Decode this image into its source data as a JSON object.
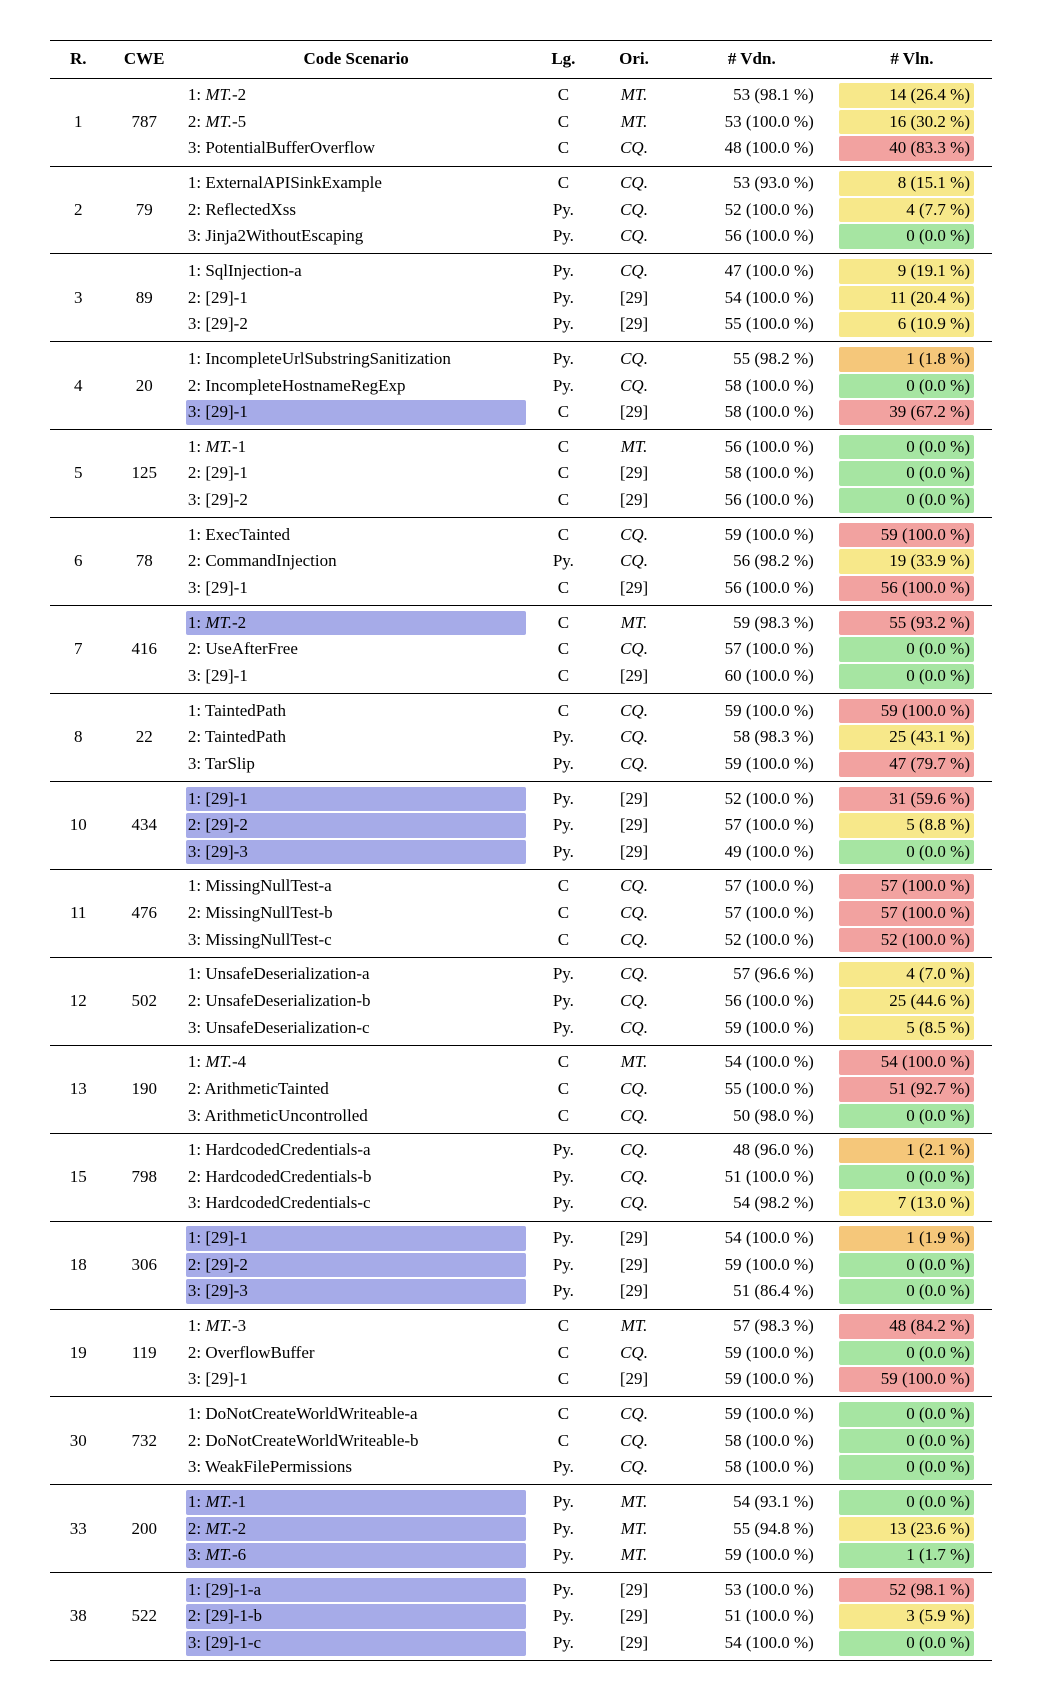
{
  "headers": {
    "r": "R.",
    "cwe": "CWE",
    "scenario": "Code Scenario",
    "lg": "Lg.",
    "ori": "Ori.",
    "vdn": "# Vdn.",
    "vln": "# Vln."
  },
  "groups": [
    {
      "rank": "1",
      "cwe": "787",
      "rows": [
        {
          "sc_pre": "1: ",
          "sc_it": "MT.",
          "sc_post": "-2",
          "sc_hl": "",
          "lg": "C",
          "ori": "MT.",
          "ori_norm": false,
          "vdn": "53 (98.1 %)",
          "vln": "14 (26.4 %)",
          "vln_hl": "hl-yellow"
        },
        {
          "sc_pre": "2: ",
          "sc_it": "MT.",
          "sc_post": "-5",
          "sc_hl": "",
          "lg": "C",
          "ori": "MT.",
          "ori_norm": false,
          "vdn": "53 (100.0 %)",
          "vln": "16 (30.2 %)",
          "vln_hl": "hl-yellow"
        },
        {
          "sc_pre": "3: PotentialBufferOverflow",
          "sc_it": "",
          "sc_post": "",
          "sc_hl": "",
          "lg": "C",
          "ori": "CQ.",
          "ori_norm": false,
          "vdn": "48 (100.0 %)",
          "vln": "40 (83.3 %)",
          "vln_hl": "hl-red"
        }
      ]
    },
    {
      "rank": "2",
      "cwe": "79",
      "rows": [
        {
          "sc_pre": "1: ExternalAPISinkExample",
          "sc_it": "",
          "sc_post": "",
          "sc_hl": "",
          "lg": "C",
          "ori": "CQ.",
          "ori_norm": false,
          "vdn": "53 (93.0 %)",
          "vln": "8 (15.1 %)",
          "vln_hl": "hl-yellow"
        },
        {
          "sc_pre": "2: ReflectedXss",
          "sc_it": "",
          "sc_post": "",
          "sc_hl": "",
          "lg": "Py.",
          "ori": "CQ.",
          "ori_norm": false,
          "vdn": "52 (100.0 %)",
          "vln": "4 (7.7 %)",
          "vln_hl": "hl-yellow"
        },
        {
          "sc_pre": "3: Jinja2WithoutEscaping",
          "sc_it": "",
          "sc_post": "",
          "sc_hl": "",
          "lg": "Py.",
          "ori": "CQ.",
          "ori_norm": false,
          "vdn": "56 (100.0 %)",
          "vln": "0 (0.0 %)",
          "vln_hl": "hl-green"
        }
      ]
    },
    {
      "rank": "3",
      "cwe": "89",
      "rows": [
        {
          "sc_pre": "1: SqlInjection-a",
          "sc_it": "",
          "sc_post": "",
          "sc_hl": "",
          "lg": "Py.",
          "ori": "CQ.",
          "ori_norm": false,
          "vdn": "47 (100.0 %)",
          "vln": "9 (19.1 %)",
          "vln_hl": "hl-yellow"
        },
        {
          "sc_pre": "2: [29]-1",
          "sc_it": "",
          "sc_post": "",
          "sc_hl": "",
          "lg": "Py.",
          "ori": "[29]",
          "ori_norm": true,
          "vdn": "54 (100.0 %)",
          "vln": "11 (20.4 %)",
          "vln_hl": "hl-yellow"
        },
        {
          "sc_pre": "3: [29]-2",
          "sc_it": "",
          "sc_post": "",
          "sc_hl": "",
          "lg": "Py.",
          "ori": "[29]",
          "ori_norm": true,
          "vdn": "55 (100.0 %)",
          "vln": "6 (10.9 %)",
          "vln_hl": "hl-yellow"
        }
      ]
    },
    {
      "rank": "4",
      "cwe": "20",
      "rows": [
        {
          "sc_pre": "1: IncompleteUrlSubstringSanitization",
          "sc_it": "",
          "sc_post": "",
          "sc_hl": "",
          "lg": "Py.",
          "ori": "CQ.",
          "ori_norm": false,
          "vdn": "55 (98.2 %)",
          "vln": "1 (1.8 %)",
          "vln_hl": "hl-orange"
        },
        {
          "sc_pre": "2: IncompleteHostnameRegExp",
          "sc_it": "",
          "sc_post": "",
          "sc_hl": "",
          "lg": "Py.",
          "ori": "CQ.",
          "ori_norm": false,
          "vdn": "58 (100.0 %)",
          "vln": "0 (0.0 %)",
          "vln_hl": "hl-green"
        },
        {
          "sc_pre": "3: [29]-1",
          "sc_it": "",
          "sc_post": "",
          "sc_hl": "hl-blue",
          "lg": "C",
          "ori": "[29]",
          "ori_norm": true,
          "vdn": "58 (100.0 %)",
          "vln": "39 (67.2 %)",
          "vln_hl": "hl-red"
        }
      ]
    },
    {
      "rank": "5",
      "cwe": "125",
      "rows": [
        {
          "sc_pre": "1: ",
          "sc_it": "MT.",
          "sc_post": "-1",
          "sc_hl": "",
          "lg": "C",
          "ori": "MT.",
          "ori_norm": false,
          "vdn": "56 (100.0 %)",
          "vln": "0 (0.0 %)",
          "vln_hl": "hl-green"
        },
        {
          "sc_pre": "2: [29]-1",
          "sc_it": "",
          "sc_post": "",
          "sc_hl": "",
          "lg": "C",
          "ori": "[29]",
          "ori_norm": true,
          "vdn": "58 (100.0 %)",
          "vln": "0 (0.0 %)",
          "vln_hl": "hl-green"
        },
        {
          "sc_pre": "3: [29]-2",
          "sc_it": "",
          "sc_post": "",
          "sc_hl": "",
          "lg": "C",
          "ori": "[29]",
          "ori_norm": true,
          "vdn": "56 (100.0 %)",
          "vln": "0 (0.0 %)",
          "vln_hl": "hl-green"
        }
      ]
    },
    {
      "rank": "6",
      "cwe": "78",
      "rows": [
        {
          "sc_pre": "1: ExecTainted",
          "sc_it": "",
          "sc_post": "",
          "sc_hl": "",
          "lg": "C",
          "ori": "CQ.",
          "ori_norm": false,
          "vdn": "59 (100.0 %)",
          "vln": "59 (100.0 %)",
          "vln_hl": "hl-red"
        },
        {
          "sc_pre": "2: CommandInjection",
          "sc_it": "",
          "sc_post": "",
          "sc_hl": "",
          "lg": "Py.",
          "ori": "CQ.",
          "ori_norm": false,
          "vdn": "56 (98.2 %)",
          "vln": "19 (33.9 %)",
          "vln_hl": "hl-yellow"
        },
        {
          "sc_pre": "3: [29]-1",
          "sc_it": "",
          "sc_post": "",
          "sc_hl": "",
          "lg": "C",
          "ori": "[29]",
          "ori_norm": true,
          "vdn": "56 (100.0 %)",
          "vln": "56 (100.0 %)",
          "vln_hl": "hl-red"
        }
      ]
    },
    {
      "rank": "7",
      "cwe": "416",
      "rows": [
        {
          "sc_pre": "1: ",
          "sc_it": "MT.",
          "sc_post": "-2",
          "sc_hl": "hl-blue",
          "lg": "C",
          "ori": "MT.",
          "ori_norm": false,
          "vdn": "59 (98.3 %)",
          "vln": "55 (93.2 %)",
          "vln_hl": "hl-red"
        },
        {
          "sc_pre": "2: UseAfterFree",
          "sc_it": "",
          "sc_post": "",
          "sc_hl": "",
          "lg": "C",
          "ori": "CQ.",
          "ori_norm": false,
          "vdn": "57 (100.0 %)",
          "vln": "0 (0.0 %)",
          "vln_hl": "hl-green"
        },
        {
          "sc_pre": "3: [29]-1",
          "sc_it": "",
          "sc_post": "",
          "sc_hl": "",
          "lg": "C",
          "ori": "[29]",
          "ori_norm": true,
          "vdn": "60 (100.0 %)",
          "vln": "0 (0.0 %)",
          "vln_hl": "hl-green"
        }
      ]
    },
    {
      "rank": "8",
      "cwe": "22",
      "rows": [
        {
          "sc_pre": "1: TaintedPath",
          "sc_it": "",
          "sc_post": "",
          "sc_hl": "",
          "lg": "C",
          "ori": "CQ.",
          "ori_norm": false,
          "vdn": "59 (100.0 %)",
          "vln": "59 (100.0 %)",
          "vln_hl": "hl-red"
        },
        {
          "sc_pre": "2: TaintedPath",
          "sc_it": "",
          "sc_post": "",
          "sc_hl": "",
          "lg": "Py.",
          "ori": "CQ.",
          "ori_norm": false,
          "vdn": "58 (98.3 %)",
          "vln": "25 (43.1 %)",
          "vln_hl": "hl-yellow"
        },
        {
          "sc_pre": "3: TarSlip",
          "sc_it": "",
          "sc_post": "",
          "sc_hl": "",
          "lg": "Py.",
          "ori": "CQ.",
          "ori_norm": false,
          "vdn": "59 (100.0 %)",
          "vln": "47 (79.7 %)",
          "vln_hl": "hl-red"
        }
      ]
    },
    {
      "rank": "10",
      "cwe": "434",
      "rows": [
        {
          "sc_pre": "1: [29]-1",
          "sc_it": "",
          "sc_post": "",
          "sc_hl": "hl-blue",
          "lg": "Py.",
          "ori": "[29]",
          "ori_norm": true,
          "vdn": "52 (100.0 %)",
          "vln": "31 (59.6 %)",
          "vln_hl": "hl-red"
        },
        {
          "sc_pre": "2: [29]-2",
          "sc_it": "",
          "sc_post": "",
          "sc_hl": "hl-blue",
          "lg": "Py.",
          "ori": "[29]",
          "ori_norm": true,
          "vdn": "57 (100.0 %)",
          "vln": "5 (8.8 %)",
          "vln_hl": "hl-yellow"
        },
        {
          "sc_pre": "3: [29]-3",
          "sc_it": "",
          "sc_post": "",
          "sc_hl": "hl-blue",
          "lg": "Py.",
          "ori": "[29]",
          "ori_norm": true,
          "vdn": "49 (100.0 %)",
          "vln": "0 (0.0 %)",
          "vln_hl": "hl-green"
        }
      ]
    },
    {
      "rank": "11",
      "cwe": "476",
      "rows": [
        {
          "sc_pre": "1: MissingNullTest-a",
          "sc_it": "",
          "sc_post": "",
          "sc_hl": "",
          "lg": "C",
          "ori": "CQ.",
          "ori_norm": false,
          "vdn": "57 (100.0 %)",
          "vln": "57 (100.0 %)",
          "vln_hl": "hl-red"
        },
        {
          "sc_pre": "2: MissingNullTest-b",
          "sc_it": "",
          "sc_post": "",
          "sc_hl": "",
          "lg": "C",
          "ori": "CQ.",
          "ori_norm": false,
          "vdn": "57 (100.0 %)",
          "vln": "57 (100.0 %)",
          "vln_hl": "hl-red"
        },
        {
          "sc_pre": "3: MissingNullTest-c",
          "sc_it": "",
          "sc_post": "",
          "sc_hl": "",
          "lg": "C",
          "ori": "CQ.",
          "ori_norm": false,
          "vdn": "52 (100.0 %)",
          "vln": "52 (100.0 %)",
          "vln_hl": "hl-red"
        }
      ]
    },
    {
      "rank": "12",
      "cwe": "502",
      "rows": [
        {
          "sc_pre": "1: UnsafeDeserialization-a",
          "sc_it": "",
          "sc_post": "",
          "sc_hl": "",
          "lg": "Py.",
          "ori": "CQ.",
          "ori_norm": false,
          "vdn": "57 (96.6 %)",
          "vln": "4 (7.0 %)",
          "vln_hl": "hl-yellow"
        },
        {
          "sc_pre": "2: UnsafeDeserialization-b",
          "sc_it": "",
          "sc_post": "",
          "sc_hl": "",
          "lg": "Py.",
          "ori": "CQ.",
          "ori_norm": false,
          "vdn": "56 (100.0 %)",
          "vln": "25 (44.6 %)",
          "vln_hl": "hl-yellow"
        },
        {
          "sc_pre": "3: UnsafeDeserialization-c",
          "sc_it": "",
          "sc_post": "",
          "sc_hl": "",
          "lg": "Py.",
          "ori": "CQ.",
          "ori_norm": false,
          "vdn": "59 (100.0 %)",
          "vln": "5 (8.5 %)",
          "vln_hl": "hl-yellow"
        }
      ]
    },
    {
      "rank": "13",
      "cwe": "190",
      "rows": [
        {
          "sc_pre": "1: ",
          "sc_it": "MT.",
          "sc_post": "-4",
          "sc_hl": "",
          "lg": "C",
          "ori": "MT.",
          "ori_norm": false,
          "vdn": "54 (100.0 %)",
          "vln": "54 (100.0 %)",
          "vln_hl": "hl-red"
        },
        {
          "sc_pre": "2: ArithmeticTainted",
          "sc_it": "",
          "sc_post": "",
          "sc_hl": "",
          "lg": "C",
          "ori": "CQ.",
          "ori_norm": false,
          "vdn": "55 (100.0 %)",
          "vln": "51 (92.7 %)",
          "vln_hl": "hl-red"
        },
        {
          "sc_pre": "3: ArithmeticUncontrolled",
          "sc_it": "",
          "sc_post": "",
          "sc_hl": "",
          "lg": "C",
          "ori": "CQ.",
          "ori_norm": false,
          "vdn": "50 (98.0 %)",
          "vln": "0 (0.0 %)",
          "vln_hl": "hl-green"
        }
      ]
    },
    {
      "rank": "15",
      "cwe": "798",
      "rows": [
        {
          "sc_pre": "1: HardcodedCredentials-a",
          "sc_it": "",
          "sc_post": "",
          "sc_hl": "",
          "lg": "Py.",
          "ori": "CQ.",
          "ori_norm": false,
          "vdn": "48 (96.0 %)",
          "vln": "1 (2.1 %)",
          "vln_hl": "hl-orange"
        },
        {
          "sc_pre": "2: HardcodedCredentials-b",
          "sc_it": "",
          "sc_post": "",
          "sc_hl": "",
          "lg": "Py.",
          "ori": "CQ.",
          "ori_norm": false,
          "vdn": "51 (100.0 %)",
          "vln": "0 (0.0 %)",
          "vln_hl": "hl-green"
        },
        {
          "sc_pre": "3: HardcodedCredentials-c",
          "sc_it": "",
          "sc_post": "",
          "sc_hl": "",
          "lg": "Py.",
          "ori": "CQ.",
          "ori_norm": false,
          "vdn": "54 (98.2 %)",
          "vln": "7 (13.0 %)",
          "vln_hl": "hl-yellow"
        }
      ]
    },
    {
      "rank": "18",
      "cwe": "306",
      "rows": [
        {
          "sc_pre": "1: [29]-1",
          "sc_it": "",
          "sc_post": "",
          "sc_hl": "hl-blue",
          "lg": "Py.",
          "ori": "[29]",
          "ori_norm": true,
          "vdn": "54 (100.0 %)",
          "vln": "1 (1.9 %)",
          "vln_hl": "hl-orange"
        },
        {
          "sc_pre": "2: [29]-2",
          "sc_it": "",
          "sc_post": "",
          "sc_hl": "hl-blue",
          "lg": "Py.",
          "ori": "[29]",
          "ori_norm": true,
          "vdn": "59 (100.0 %)",
          "vln": "0 (0.0 %)",
          "vln_hl": "hl-green"
        },
        {
          "sc_pre": "3: [29]-3",
          "sc_it": "",
          "sc_post": "",
          "sc_hl": "hl-blue",
          "lg": "Py.",
          "ori": "[29]",
          "ori_norm": true,
          "vdn": "51 (86.4 %)",
          "vln": "0 (0.0 %)",
          "vln_hl": "hl-green"
        }
      ]
    },
    {
      "rank": "19",
      "cwe": "119",
      "rows": [
        {
          "sc_pre": "1: ",
          "sc_it": "MT.",
          "sc_post": "-3",
          "sc_hl": "",
          "lg": "C",
          "ori": "MT.",
          "ori_norm": false,
          "vdn": "57 (98.3 %)",
          "vln": "48 (84.2 %)",
          "vln_hl": "hl-red"
        },
        {
          "sc_pre": "2: OverflowBuffer",
          "sc_it": "",
          "sc_post": "",
          "sc_hl": "",
          "lg": "C",
          "ori": "CQ.",
          "ori_norm": false,
          "vdn": "59 (100.0 %)",
          "vln": "0 (0.0 %)",
          "vln_hl": "hl-green"
        },
        {
          "sc_pre": "3: [29]-1",
          "sc_it": "",
          "sc_post": "",
          "sc_hl": "",
          "lg": "C",
          "ori": "[29]",
          "ori_norm": true,
          "vdn": "59 (100.0 %)",
          "vln": "59 (100.0 %)",
          "vln_hl": "hl-red"
        }
      ]
    },
    {
      "rank": "30",
      "cwe": "732",
      "rows": [
        {
          "sc_pre": "1: DoNotCreateWorldWriteable-a",
          "sc_it": "",
          "sc_post": "",
          "sc_hl": "",
          "lg": "C",
          "ori": "CQ.",
          "ori_norm": false,
          "vdn": "59 (100.0 %)",
          "vln": "0 (0.0 %)",
          "vln_hl": "hl-green"
        },
        {
          "sc_pre": "2: DoNotCreateWorldWriteable-b",
          "sc_it": "",
          "sc_post": "",
          "sc_hl": "",
          "lg": "C",
          "ori": "CQ.",
          "ori_norm": false,
          "vdn": "58 (100.0 %)",
          "vln": "0 (0.0 %)",
          "vln_hl": "hl-green"
        },
        {
          "sc_pre": "3: WeakFilePermissions",
          "sc_it": "",
          "sc_post": "",
          "sc_hl": "",
          "lg": "Py.",
          "ori": "CQ.",
          "ori_norm": false,
          "vdn": "58 (100.0 %)",
          "vln": "0 (0.0 %)",
          "vln_hl": "hl-green"
        }
      ]
    },
    {
      "rank": "33",
      "cwe": "200",
      "rows": [
        {
          "sc_pre": "1: ",
          "sc_it": "MT.",
          "sc_post": "-1",
          "sc_hl": "hl-blue",
          "lg": "Py.",
          "ori": "MT.",
          "ori_norm": false,
          "vdn": "54 (93.1 %)",
          "vln": "0 (0.0 %)",
          "vln_hl": "hl-green"
        },
        {
          "sc_pre": "2: ",
          "sc_it": "MT.",
          "sc_post": "-2",
          "sc_hl": "hl-blue",
          "lg": "Py.",
          "ori": "MT.",
          "ori_norm": false,
          "vdn": "55 (94.8 %)",
          "vln": "13 (23.6 %)",
          "vln_hl": "hl-yellow"
        },
        {
          "sc_pre": "3: ",
          "sc_it": "MT.",
          "sc_post": "-6",
          "sc_hl": "hl-blue",
          "lg": "Py.",
          "ori": "MT.",
          "ori_norm": false,
          "vdn": "59 (100.0 %)",
          "vln": "1 (1.7 %)",
          "vln_hl": "hl-green"
        }
      ]
    },
    {
      "rank": "38",
      "cwe": "522",
      "rows": [
        {
          "sc_pre": "1: [29]-1-a",
          "sc_it": "",
          "sc_post": "",
          "sc_hl": "hl-blue",
          "lg": "Py.",
          "ori": "[29]",
          "ori_norm": true,
          "vdn": "53 (100.0 %)",
          "vln": "52 (98.1 %)",
          "vln_hl": "hl-red"
        },
        {
          "sc_pre": "2: [29]-1-b",
          "sc_it": "",
          "sc_post": "",
          "sc_hl": "hl-blue",
          "lg": "Py.",
          "ori": "[29]",
          "ori_norm": true,
          "vdn": "51 (100.0 %)",
          "vln": "3 (5.9 %)",
          "vln_hl": "hl-yellow"
        },
        {
          "sc_pre": "3: [29]-1-c",
          "sc_it": "",
          "sc_post": "",
          "sc_hl": "hl-blue",
          "lg": "Py.",
          "ori": "[29]",
          "ori_norm": true,
          "vdn": "54 (100.0 %)",
          "vln": "0 (0.0 %)",
          "vln_hl": "hl-green"
        }
      ]
    }
  ]
}
